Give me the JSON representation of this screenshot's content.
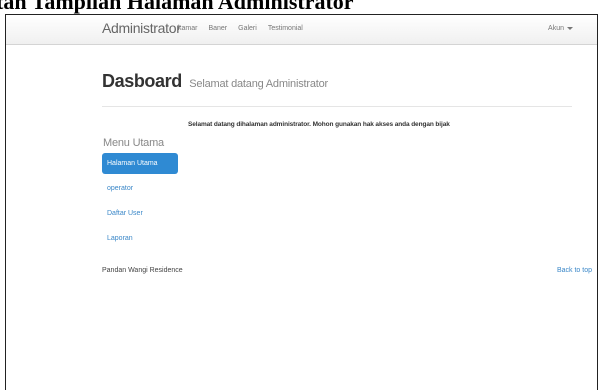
{
  "caption": "tan Tampilan Halaman Administrator",
  "navbar": {
    "brand": "Administrator",
    "links": [
      "kamar",
      "Baner",
      "Galeri",
      "Testimonial"
    ],
    "account_label": "Akun"
  },
  "header": {
    "title": "Dasboard",
    "subtitle": "Selamat datang Administrator"
  },
  "welcome_message": "Selamat datang dihalaman administrator. Mohon gunakan hak akses anda dengan bijak",
  "sidebar": {
    "heading": "Menu Utama",
    "items": [
      {
        "label": "Halaman Utama",
        "active": true
      },
      {
        "label": "operator",
        "active": false
      },
      {
        "label": "Daftar User",
        "active": false
      },
      {
        "label": "Laporan",
        "active": false
      }
    ]
  },
  "footer": {
    "left_text": "Pandan Wangi Residence",
    "back_to_top": "Back to top"
  },
  "colors": {
    "accent": "#2f8ad3",
    "link": "#3a87c8"
  }
}
